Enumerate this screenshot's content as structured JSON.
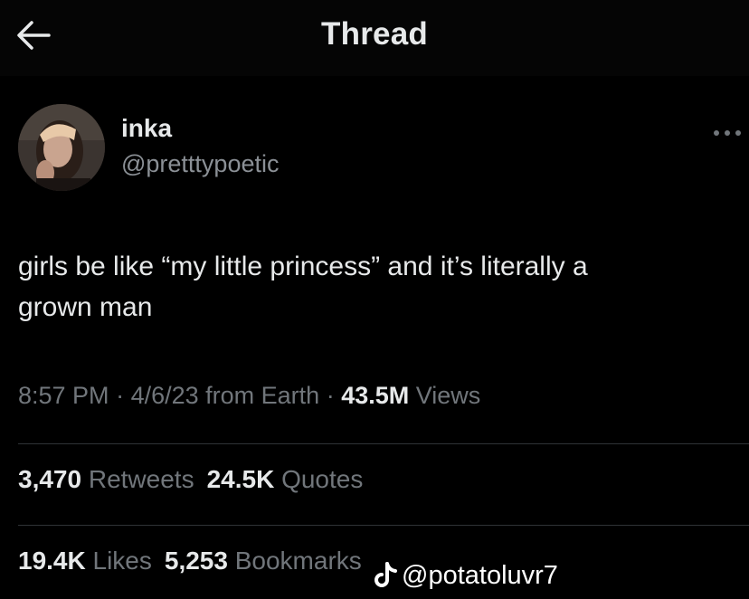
{
  "header": {
    "title": "Thread",
    "back_icon": "arrow-left-icon"
  },
  "author": {
    "display_name": "inka",
    "handle": "@pretttypoetic",
    "more_icon": "ellipsis-icon"
  },
  "tweet": {
    "text_line1": "girls be like “my little princess” and it’s literally a",
    "text_line2": "grown man"
  },
  "meta": {
    "time": "8:57 PM",
    "sep1": " · ",
    "date": "4/6/23",
    "source": " from Earth",
    "sep2": " · ",
    "views_count": "43.5M",
    "views_label": " Views"
  },
  "stats_row1": {
    "retweets_count": "3,470",
    "retweets_label": " Retweets",
    "quotes_count": "24.5K",
    "quotes_label": " Quotes"
  },
  "stats_row2": {
    "likes_count": "19.4K",
    "likes_label": " Likes",
    "bookmarks_count": "5,253",
    "bookmarks_label": " Bookmarks"
  },
  "watermark": {
    "icon": "tiktok-icon",
    "text": "@potatoluvr7"
  },
  "colors": {
    "background": "#000000",
    "text_primary": "#e7e9ea",
    "text_secondary": "#71767b",
    "divider": "#2f3336"
  }
}
